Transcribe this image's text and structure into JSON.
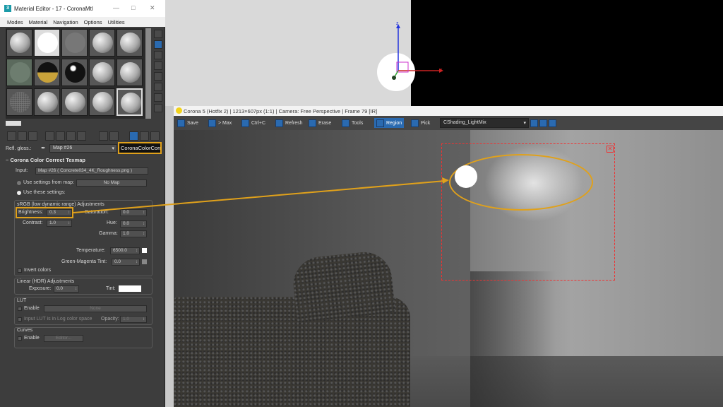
{
  "material_editor": {
    "title": "Material Editor - 17 - CoronaMtl",
    "menu": [
      "Modes",
      "Material",
      "Navigation",
      "Options",
      "Utilities"
    ],
    "refl_gloss_label": "Refl. gloss.:",
    "map_dropdown": "Map #26",
    "map_type": "CoronaColorCorrect",
    "rollout_title": "Corona Color Correct Texmap",
    "input_label": "Input:",
    "input_value": "Map #26 ( Concrete034_4K_Roughness.png )",
    "use_settings_from_map": "Use settings from map:",
    "no_map": "No Map",
    "use_these_settings": "Use these settings:",
    "srgb_group": "sRGB (low dynamic range) Adjustments",
    "brightness_label": "Brightness:",
    "brightness_value": "0.3",
    "saturation_label": "Saturation:",
    "saturation_value": "0.0",
    "contrast_label": "Contrast:",
    "contrast_value": "1.0",
    "hue_label": "Hue:",
    "hue_value": "0.0",
    "gamma_label": "Gamma:",
    "gamma_value": "1.0",
    "temperature_label": "Temperature:",
    "temperature_value": "6500.0",
    "gm_tint_label": "Green-Magenta Tint:",
    "gm_tint_value": "0.0",
    "invert_colors": "Invert colors",
    "linear_group": "Linear (HDR) Adjustments",
    "exposure_label": "Exposure:",
    "exposure_value": "0.0",
    "tint_label": "Tint:",
    "lut_group": "LUT",
    "lut_enable": "Enable",
    "lut_none": "None",
    "lut_log": "Input LUT is in Log color space",
    "opacity_label": "Opacity:",
    "opacity_value": "1.0",
    "curves_group": "Curves",
    "curves_enable": "Enable",
    "curves_editor": "Editor..."
  },
  "vfb": {
    "title": "Corona 5 (Hotfix 2) | 1213×607px (1:1) | Camera: Free Perspective | Frame 79 [IR]",
    "save": "Save",
    "to_max": "> Max",
    "ctrl_c": "Ctrl+C",
    "refresh": "Refresh",
    "erase": "Erase",
    "tools": "Tools",
    "region": "Region",
    "pick": "Pick",
    "lightmix": "CShading_LightMix"
  },
  "viewport": {
    "axis_z": "z",
    "axis_x": "x"
  },
  "colors": {
    "highlight": "#e0a11b",
    "region": "#ee3333",
    "accent": "#2a6ab0"
  }
}
